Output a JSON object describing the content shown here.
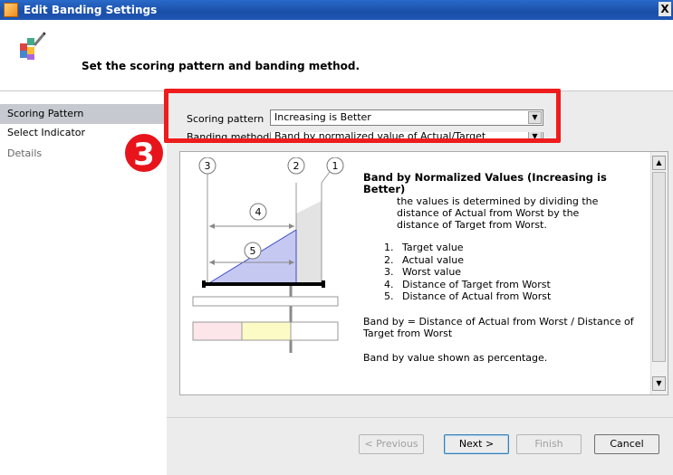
{
  "window": {
    "title": "Edit Banding Settings",
    "close_glyph": "X"
  },
  "header": {
    "heading": "Set the scoring pattern and banding method."
  },
  "sidebar": {
    "items": [
      {
        "label": "Scoring Pattern"
      },
      {
        "label": "Select Indicator"
      },
      {
        "label": "Details"
      }
    ]
  },
  "form": {
    "scoring_label": "Scoring pattern",
    "scoring_value": "Increasing is Better",
    "banding_label": "Banding method",
    "banding_value": "Band by normalized value of Actual/Target"
  },
  "annotation": {
    "step_number": "3"
  },
  "diagram": {
    "callouts": [
      "3",
      "2",
      "1",
      "4",
      "5"
    ]
  },
  "description": {
    "title": "Band by Normalized Values (Increasing is Better)",
    "intro_lines": [
      "the values is determined by dividing the",
      "distance of Actual from Worst by the",
      "distance of Target from Worst."
    ],
    "legend": [
      "Target value",
      "Actual value",
      "Worst value",
      "Distance of Target from Worst",
      "Distance of Actual from Worst"
    ],
    "formula": "Band by = Distance of Actual from Worst / Distance of Target from Worst",
    "note": "Band by value shown as percentage."
  },
  "buttons": {
    "previous": "< Previous",
    "next": "Next >",
    "finish": "Finish",
    "cancel": "Cancel"
  },
  "colors": {
    "accent_red": "#ee1c1c",
    "title_blue": "#1a4fa8",
    "triangle_fill": "#c5c9f2",
    "band_pink": "#fde6ea",
    "band_yellow": "#fdfbc5"
  }
}
